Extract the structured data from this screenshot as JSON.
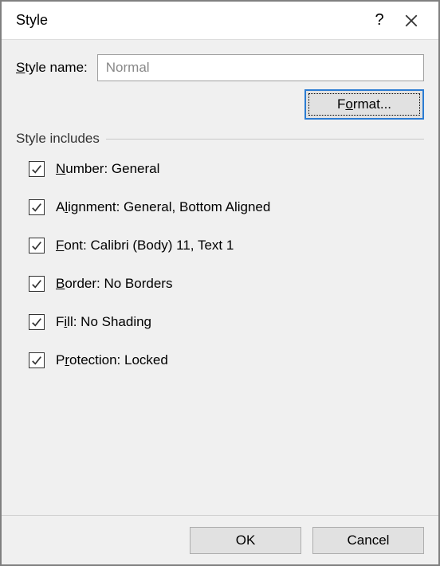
{
  "dialog": {
    "title": "Style"
  },
  "styleName": {
    "label_pre": "",
    "label_hotkey": "S",
    "label_post": "tyle name:",
    "value": "Normal"
  },
  "format": {
    "label_pre": "F",
    "label_hotkey": "o",
    "label_post": "rmat..."
  },
  "group": {
    "label": "Style includes"
  },
  "includes": [
    {
      "checked": true,
      "pre": "",
      "hk": "N",
      "post": "umber: General"
    },
    {
      "checked": true,
      "pre": "A",
      "hk": "l",
      "post": "ignment: General, Bottom Aligned"
    },
    {
      "checked": true,
      "pre": "",
      "hk": "F",
      "post": "ont: Calibri (Body) 11, Text 1"
    },
    {
      "checked": true,
      "pre": "",
      "hk": "B",
      "post": "order: No Borders"
    },
    {
      "checked": true,
      "pre": "F",
      "hk": "i",
      "post": "ll: No Shading"
    },
    {
      "checked": true,
      "pre": "P",
      "hk": "r",
      "post": "otection: Locked"
    }
  ],
  "buttons": {
    "ok": "OK",
    "cancel": "Cancel"
  }
}
